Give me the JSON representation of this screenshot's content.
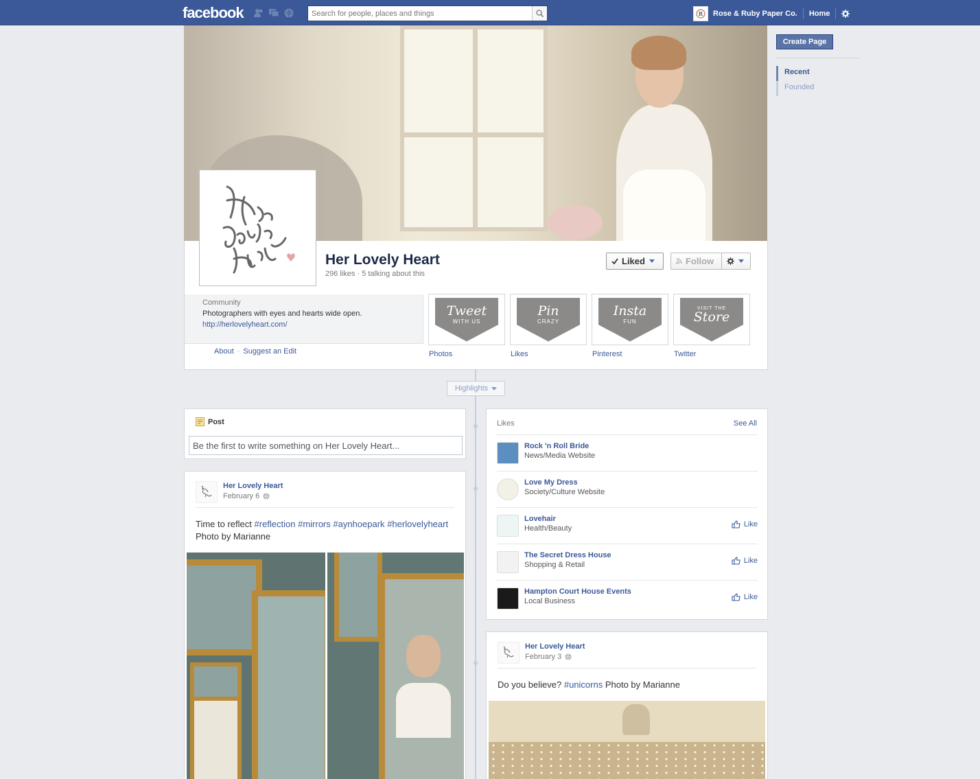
{
  "topbar": {
    "logo": "facebook",
    "search_placeholder": "Search for people, places and things",
    "account_name": "Rose & Ruby Paper Co.",
    "home_label": "Home",
    "icons": [
      "friend-requests-icon",
      "messages-icon",
      "notifications-icon",
      "search-icon",
      "gear-icon"
    ]
  },
  "page": {
    "name": "Her Lovely Heart",
    "stats": "296 likes · 5 talking about this",
    "liked_label": "Liked",
    "follow_label": "Follow",
    "profile_logo_text": "Her Lovely Heart"
  },
  "about": {
    "category": "Community",
    "description": "Photographers with eyes and hearts wide open.",
    "website": "http://herlovelyheart.com/",
    "about_link": "About",
    "separator": "·",
    "suggest_link": "Suggest an Edit"
  },
  "apps": [
    {
      "label": "Photos",
      "badge_script": "Tweet",
      "badge_small": "WITH US"
    },
    {
      "label": "Likes",
      "badge_script": "Pin",
      "badge_small": "CRAZY"
    },
    {
      "label": "Pinterest",
      "badge_script": "Insta",
      "badge_small": "FUN"
    },
    {
      "label": "Twitter",
      "badge_top": "VISIT THE",
      "badge_script": "Store"
    }
  ],
  "timeline": {
    "highlights_label": "Highlights"
  },
  "composer": {
    "title": "Post",
    "placeholder": "Be the first to write something on Her Lovely Heart..."
  },
  "posts": [
    {
      "author": "Her Lovely Heart",
      "date": "February 6",
      "text_plain_start": "Time to reflect ",
      "tags": [
        "#reflection",
        "#mirrors",
        "#aynhoepark",
        "#herlovelyheart"
      ],
      "text_plain_end": " Photo by Marianne"
    },
    {
      "author": "Her Lovely Heart",
      "date": "February 3",
      "text_plain_start": "Do you believe? ",
      "tags": [
        "#unicorns"
      ],
      "text_plain_end": " Photo by Marianne"
    }
  ],
  "likes": {
    "header": "Likes",
    "see_all": "See All",
    "like_label": "Like",
    "items": [
      {
        "name": "Rock 'n Roll Bride",
        "category": "News/Media Website",
        "show_like": false,
        "thumb_color": "#5a8fbf"
      },
      {
        "name": "Love My Dress",
        "category": "Society/Culture Website",
        "show_like": false,
        "thumb_color": "#f3f0e6"
      },
      {
        "name": "Lovehair",
        "category": "Health/Beauty",
        "show_like": true,
        "thumb_color": "#eef6f5"
      },
      {
        "name": "The Secret Dress House",
        "category": "Shopping & Retail",
        "show_like": true,
        "thumb_color": "#f2f2f2"
      },
      {
        "name": "Hampton Court House Events",
        "category": "Local Business",
        "show_like": true,
        "thumb_color": "#1a1a1a"
      }
    ]
  },
  "rightcol": {
    "create_page": "Create Page",
    "years": [
      "Recent",
      "Founded"
    ]
  },
  "colors": {
    "brand_blue": "#3b5998",
    "link_blue": "#3b5998",
    "badge_gray": "#8c8989"
  }
}
